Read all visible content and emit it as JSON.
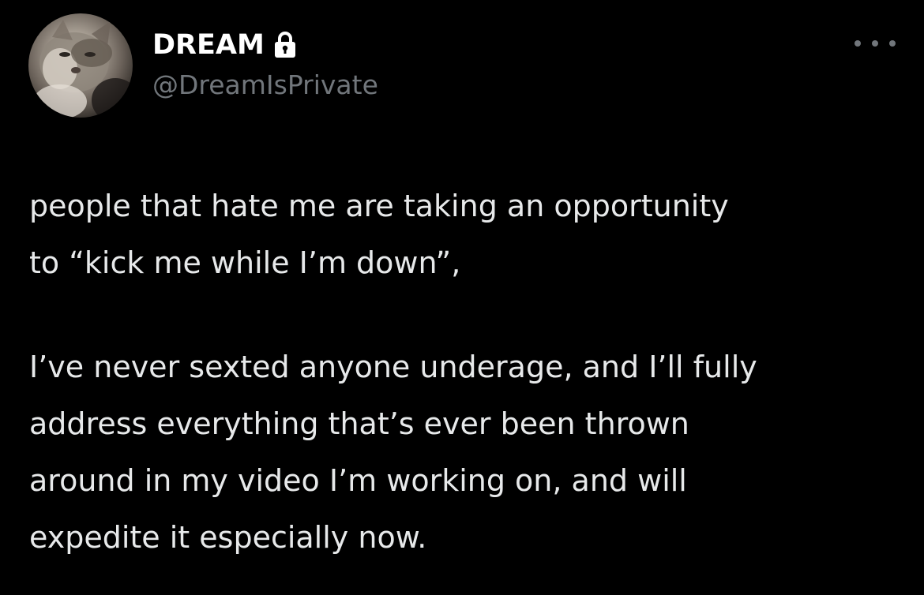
{
  "post": {
    "author": {
      "display_name": "DREAM",
      "handle": "@DreamIsPrivate",
      "avatar_icon": "cat-avatar",
      "protected_icon": "lock-icon"
    },
    "more_icon": "more-options-icon",
    "paragraphs": [
      {
        "lines": [
          "people that hate me are taking an opportunity",
          "to “kick me while I’m down”,"
        ]
      },
      {
        "lines": [
          "I’ve never sexted anyone underage, and I’ll fully",
          "address everything that’s ever been thrown",
          "around in my video I’m working on, and will",
          "expedite it especially now."
        ]
      }
    ]
  },
  "colors": {
    "background": "#000000",
    "primary_text": "#e7e9ea",
    "name_text": "#ffffff",
    "secondary_text": "#71767b"
  }
}
